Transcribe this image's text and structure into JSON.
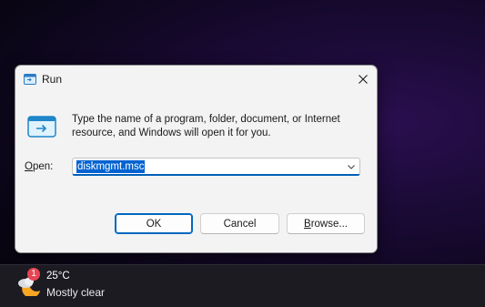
{
  "dialog": {
    "title": "Run",
    "message": "Type the name of a program, folder, document, or Internet resource, and Windows will open it for you.",
    "open_label_accel": "O",
    "open_label_rest": "pen:",
    "open_value": "diskmgmt.msc",
    "ok_label": "OK",
    "cancel_label": "Cancel",
    "browse_label_accel": "B",
    "browse_label_rest": "rowse...",
    "title_icon": "run-icon",
    "close_icon": "close-icon",
    "dropdown_icon": "chevron-down-icon"
  },
  "taskbar": {
    "weather": {
      "icon": "partly-cloudy-night-icon",
      "badge": "1",
      "temperature": "25°C",
      "condition": "Mostly clear"
    }
  },
  "colors": {
    "accent": "#0067c0",
    "selection": "#0063d1",
    "badge": "#e64553",
    "dialog_bg": "#f3f3f3"
  }
}
